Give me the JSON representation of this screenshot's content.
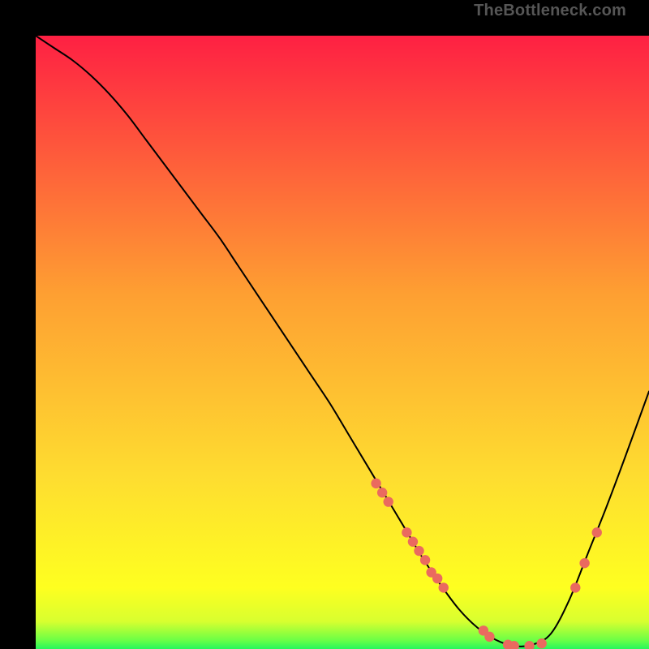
{
  "watermark": "TheBottleneck.com",
  "colors": {
    "gradient_top": "#fe2043",
    "gradient_mid": "#fedd30",
    "gradient_low": "#feff20",
    "gradient_bottom": "#25f75c",
    "curve": "#000000",
    "marker": "#ea6a5f",
    "background": "#000000"
  },
  "chart_data": {
    "type": "line",
    "title": "",
    "xlabel": "",
    "ylabel": "",
    "xlim": [
      0,
      100
    ],
    "ylim": [
      0,
      100
    ],
    "grid": false,
    "legend": false,
    "x": [
      0,
      3,
      6,
      9,
      12,
      15,
      18,
      21,
      24,
      27,
      30,
      33,
      36,
      39,
      42,
      45,
      48,
      51,
      54,
      57,
      60,
      63,
      66,
      69,
      72,
      75,
      78,
      81,
      84,
      87,
      90,
      93,
      96,
      100
    ],
    "y": [
      100,
      98,
      96,
      93.5,
      90.5,
      87,
      83,
      79,
      75,
      71,
      67,
      62.5,
      58,
      53.5,
      49,
      44.5,
      40,
      35,
      30,
      25,
      20,
      15,
      10.5,
      6.5,
      3.5,
      1.5,
      0.5,
      0.7,
      2.5,
      8,
      15.5,
      23,
      31,
      42
    ],
    "markers": {
      "x": [
        55.5,
        56.5,
        57.5,
        60.5,
        61.5,
        62.5,
        63.5,
        64.5,
        65.5,
        66.5,
        73.0,
        74.0,
        77.0,
        78.0,
        80.5,
        82.5,
        88.0,
        89.5,
        91.5
      ],
      "y": [
        27.0,
        25.5,
        24.0,
        19.0,
        17.5,
        16.0,
        14.5,
        12.5,
        11.5,
        10.0,
        3.0,
        2.0,
        0.7,
        0.5,
        0.5,
        0.9,
        10.0,
        14.0,
        19.0
      ]
    }
  }
}
